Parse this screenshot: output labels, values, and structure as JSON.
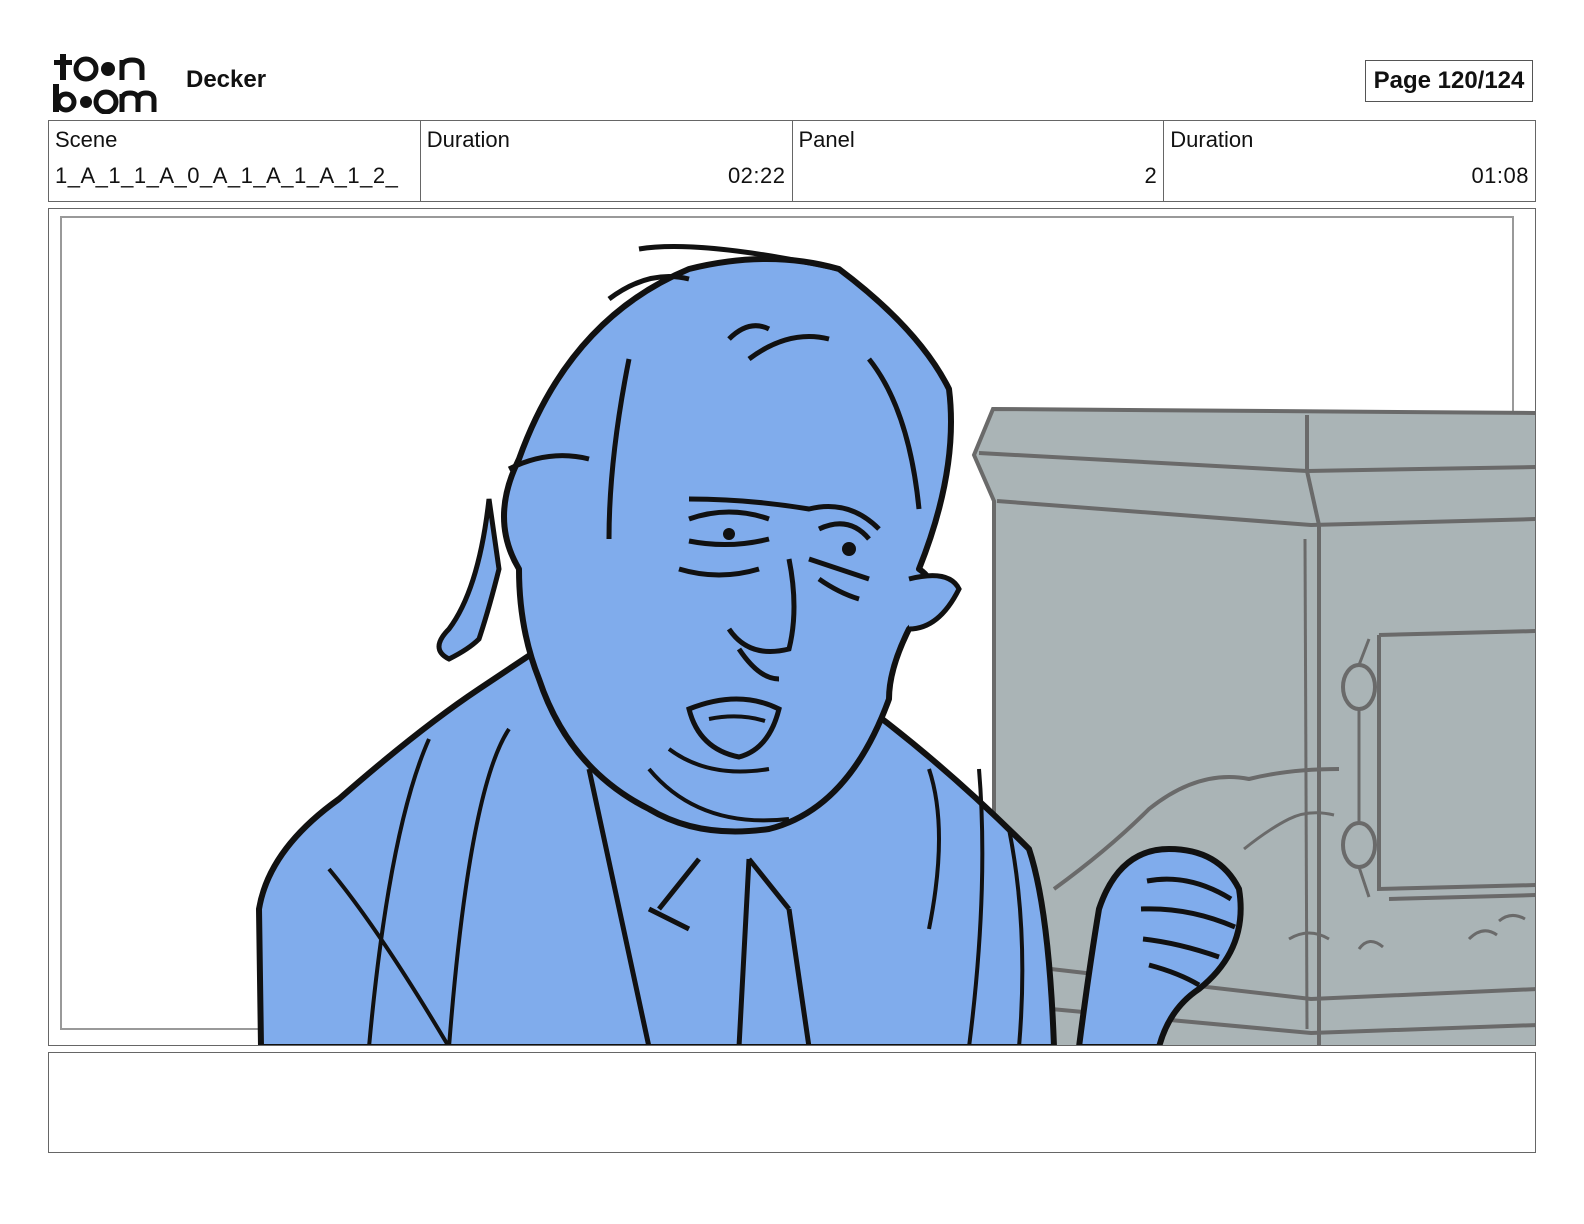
{
  "header": {
    "logo_text": "toonboom",
    "project_name": "Decker",
    "page_indicator": "Page 120/124"
  },
  "info": {
    "scene_label": "Scene",
    "scene_value": "1_A_1_1_A_0_A_1_A_1_A_1_2_",
    "scene_duration_label": "Duration",
    "scene_duration_value": "02:22",
    "panel_label": "Panel",
    "panel_value": "2",
    "panel_duration_label": "Duration",
    "panel_duration_value": "01:08"
  },
  "artwork": {
    "character_fill": "#80acec",
    "prop_fill": "#aab4b6",
    "line_color": "#111111",
    "prop_line_color": "#6a6a6a"
  },
  "notes": {
    "text": ""
  }
}
